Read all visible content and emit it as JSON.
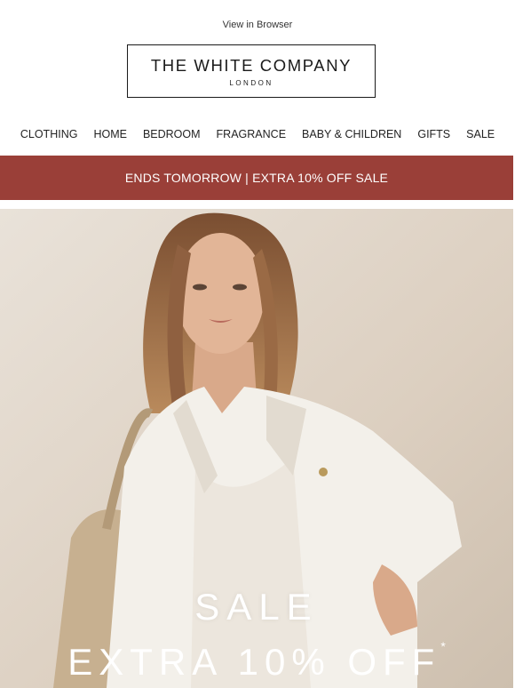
{
  "header": {
    "view_in_browser": "View in Browser",
    "logo_main": "THE WHITE COMPANY",
    "logo_sub": "LONDON"
  },
  "nav": {
    "items": [
      "CLOTHING",
      "HOME",
      "BEDROOM",
      "FRAGRANCE",
      "BABY & CHILDREN",
      "GIFTS",
      "SALE"
    ]
  },
  "banner": {
    "text": "ENDS TOMORROW | EXTRA 10% OFF SALE",
    "color": "#9a3f38"
  },
  "hero": {
    "headline": "SALE",
    "subheadline": "EXTRA 10% OFF",
    "asterisk": "*"
  }
}
